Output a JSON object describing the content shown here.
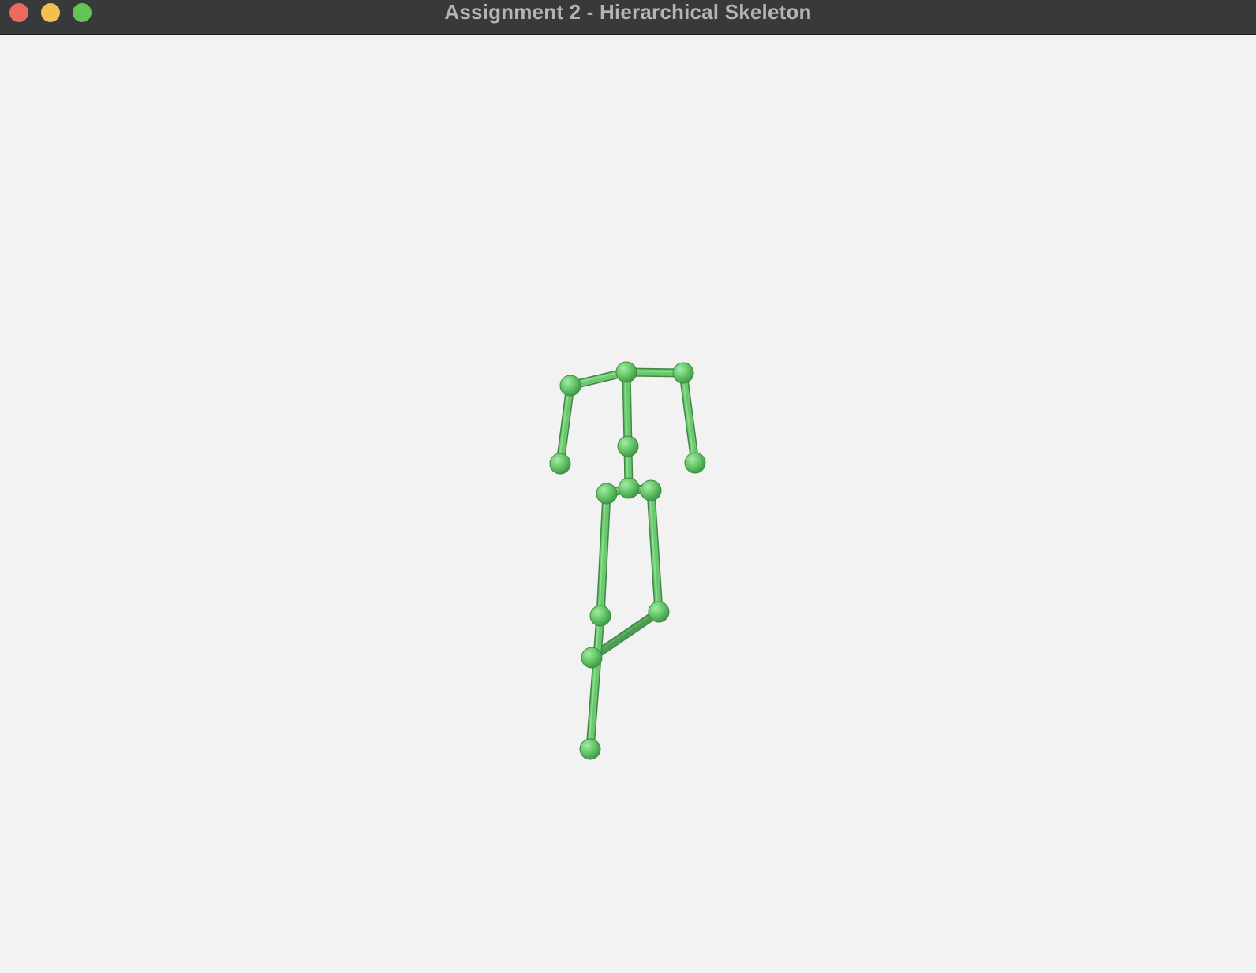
{
  "window": {
    "title": "Assignment 2 - Hierarchical Skeleton",
    "controls": {
      "close": {
        "icon": "close-icon",
        "color": "#ec6a5f"
      },
      "minimize": {
        "icon": "minimize-icon",
        "color": "#f4bf4f"
      },
      "zoom": {
        "icon": "zoom-icon",
        "color": "#61c554"
      }
    }
  },
  "canvas": {
    "background": "#f2f2f2",
    "render": "3D stick-figure skeleton of spheres (joints) and cylinders (bones)",
    "colors": {
      "joint": "#6fce72",
      "joint_highlight": "#a6eaa6",
      "joint_shadow": "#3f9a45",
      "bone": "#6cc870",
      "bone_back": "#4e9b52",
      "bone_edge": "#3d8a42"
    }
  }
}
